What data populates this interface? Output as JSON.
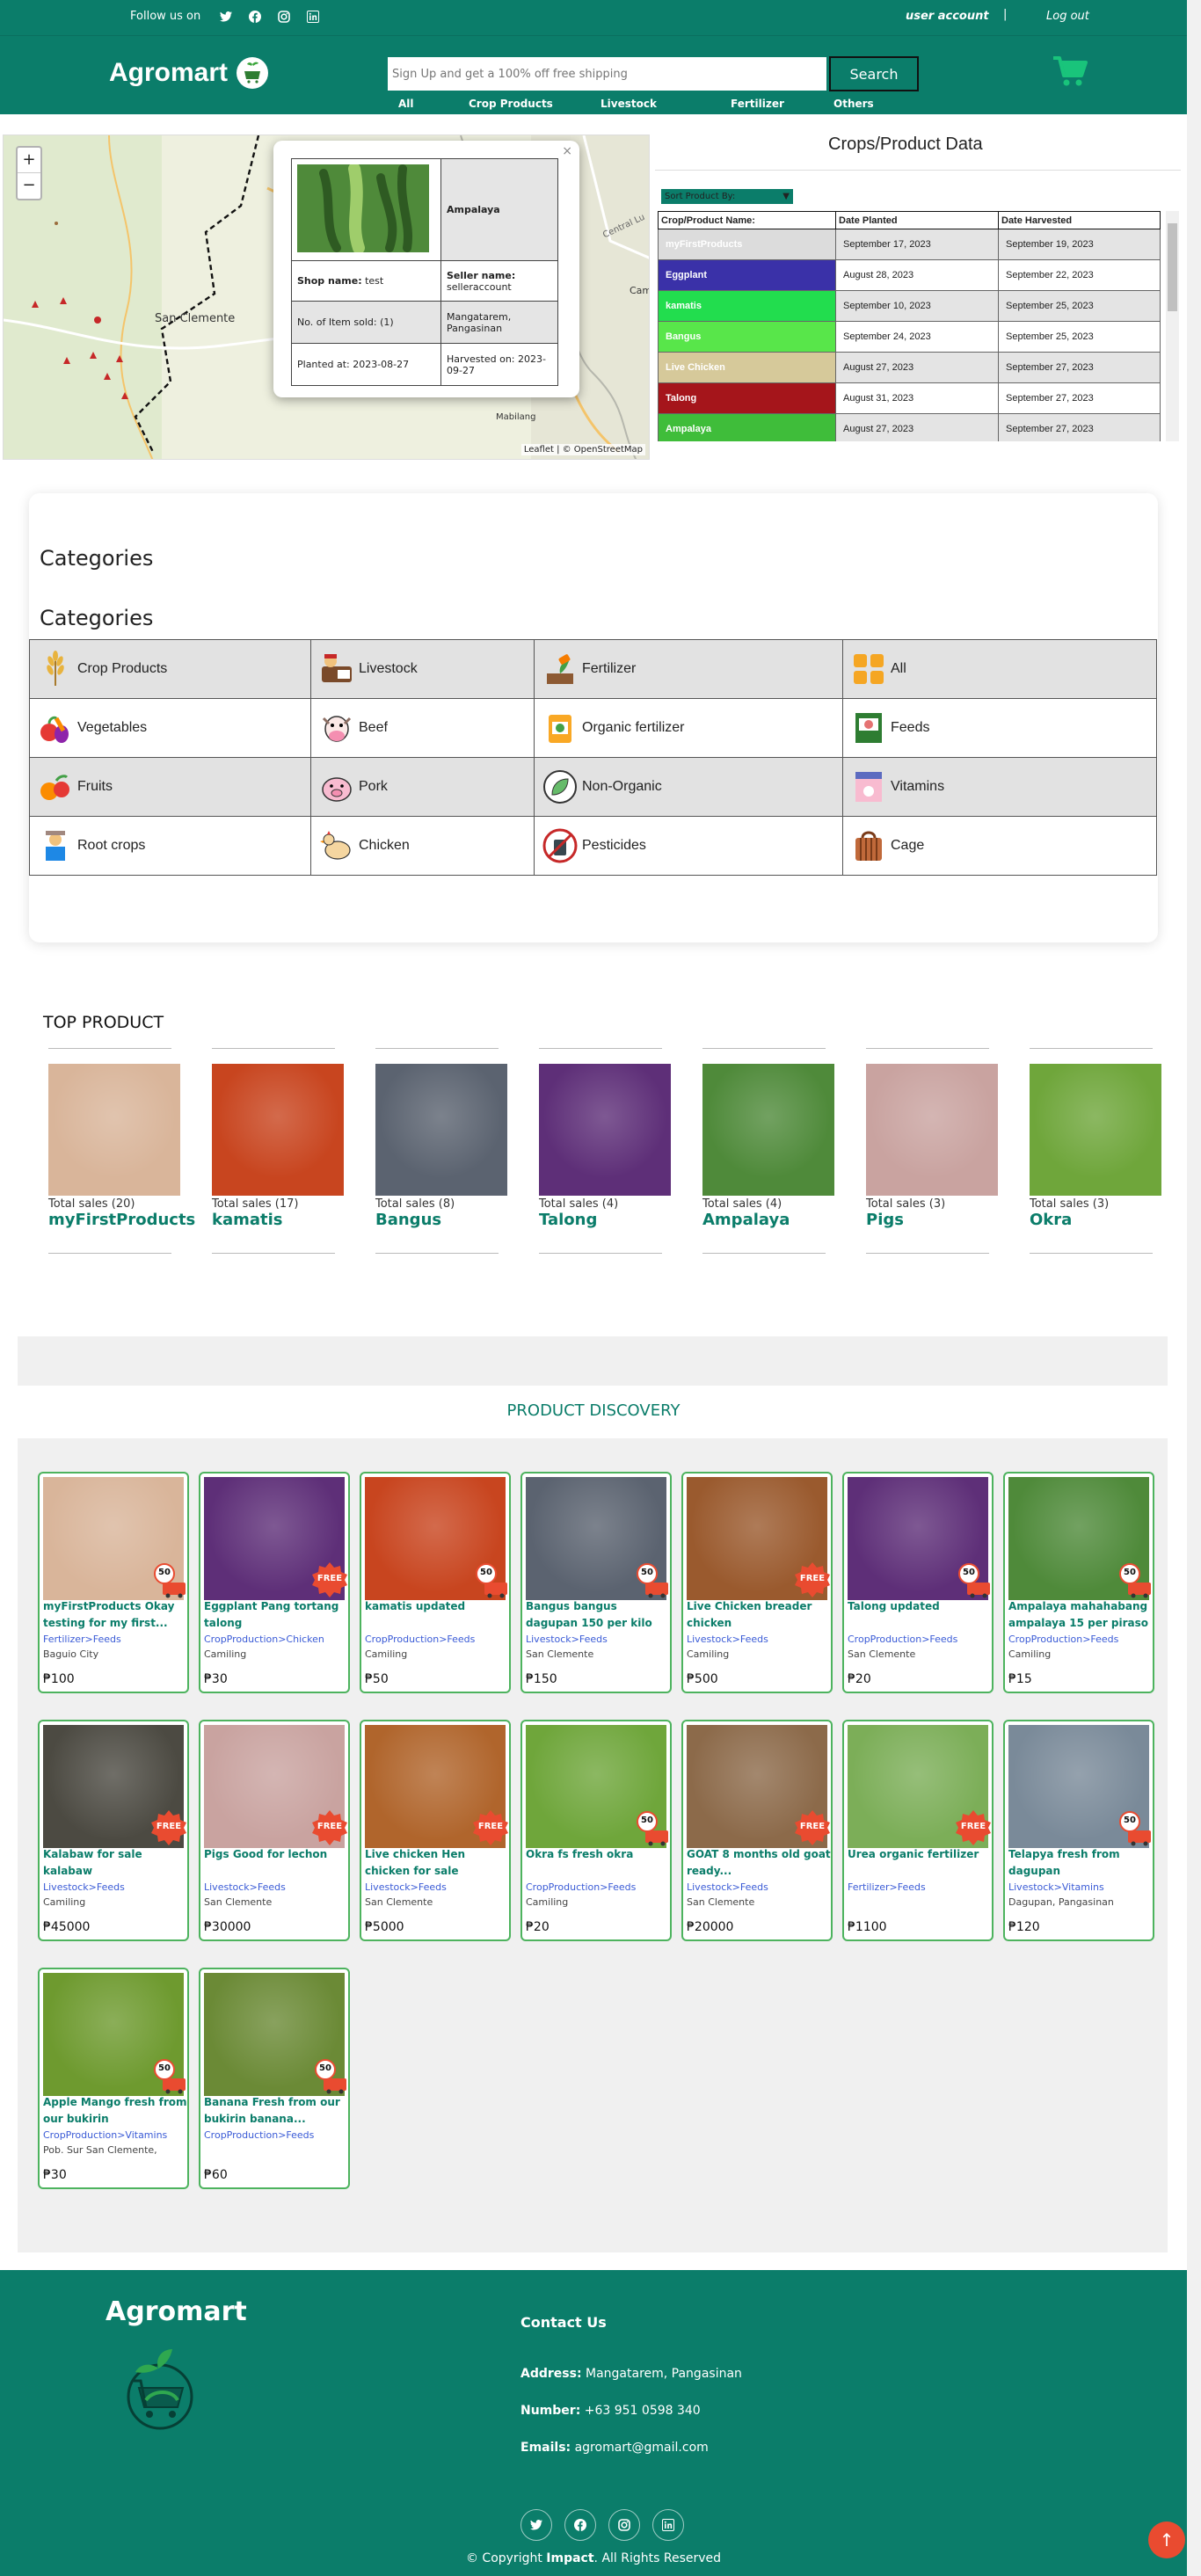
{
  "topbar": {
    "follow": "Follow us on",
    "user_account": "user account",
    "separator": "|",
    "logout": "Log out"
  },
  "header": {
    "brand": "Agromart",
    "search_placeholder": "Sign Up and get a 100% off free shipping",
    "search_button": "Search",
    "nav": [
      "All",
      "Crop Products",
      "Livestock",
      "Fertilizer",
      "Others"
    ]
  },
  "map": {
    "zoom_in": "+",
    "zoom_out": "−",
    "labels": [
      "San Clemente",
      "Camiling",
      "Mabilang",
      "Central Lu"
    ],
    "attribution": "Leaflet | © OpenStreetMap",
    "popup": {
      "close": "×",
      "name": "Ampalaya",
      "shop_label": "Shop name:",
      "shop_value": "test",
      "seller_label": "Seller name:",
      "seller_value": "selleraccount",
      "items_sold": "No. of Item sold: (1)",
      "location": "Mangatarem, Pangasinan",
      "planted": "Planted at: 2023-08-27",
      "harvested": "Harvested on: 2023-09-27"
    }
  },
  "crops": {
    "title": "Crops/Product Data",
    "sort_label": "Sort Product By:",
    "headers": [
      "Crop/Product Name:",
      "Date Planted",
      "Date Harvested"
    ],
    "rows": [
      {
        "name": "myFirstProducts",
        "planted": "September 17, 2023",
        "harvested": "September 19, 2023",
        "color": "#dcdcdc"
      },
      {
        "name": "Eggplant",
        "planted": "August 28, 2023",
        "harvested": "September 22, 2023",
        "color": "#3a31a8"
      },
      {
        "name": "kamatis",
        "planted": "September 10, 2023",
        "harvested": "September 25, 2023",
        "color": "#22dd4e"
      },
      {
        "name": "Bangus",
        "planted": "September 24, 2023",
        "harvested": "September 25, 2023",
        "color": "#58e64a"
      },
      {
        "name": "Live Chicken",
        "planted": "August 27, 2023",
        "harvested": "September 27, 2023",
        "color": "#d6c99a"
      },
      {
        "name": "Talong",
        "planted": "August 31, 2023",
        "harvested": "September 27, 2023",
        "color": "#a5151b"
      },
      {
        "name": "Ampalaya",
        "planted": "August 27, 2023",
        "harvested": "September 27, 2023",
        "color": "#3fbd3a"
      }
    ]
  },
  "categories": {
    "heading1": "Categories",
    "heading2": "Categories",
    "rows": [
      [
        {
          "label": "Crop Products",
          "icon": "wheat-icon"
        },
        {
          "label": "Livestock",
          "icon": "farmer-cow-icon"
        },
        {
          "label": "Fertilizer",
          "icon": "fertilizer-icon"
        },
        {
          "label": "All",
          "icon": "grid-icon"
        }
      ],
      [
        {
          "label": "Vegetables",
          "icon": "vegetables-icon"
        },
        {
          "label": "Beef",
          "icon": "cow-icon"
        },
        {
          "label": "Organic fertilizer",
          "icon": "organic-fertilizer-icon"
        },
        {
          "label": "Feeds",
          "icon": "feeds-icon"
        }
      ],
      [
        {
          "label": "Fruits",
          "icon": "fruits-icon"
        },
        {
          "label": "Pork",
          "icon": "pig-icon"
        },
        {
          "label": "Non-Organic",
          "icon": "leaf-icon"
        },
        {
          "label": "Vitamins",
          "icon": "vitamins-icon"
        }
      ],
      [
        {
          "label": "Root crops",
          "icon": "farmer-icon"
        },
        {
          "label": "Chicken",
          "icon": "chicken-icon"
        },
        {
          "label": "Pesticides",
          "icon": "pesticide-icon"
        },
        {
          "label": "Cage",
          "icon": "cage-icon"
        }
      ]
    ]
  },
  "top_products": {
    "title": "TOP PRODUCT",
    "items": [
      {
        "sales": "Total sales (20)",
        "name": "myFirstProducts",
        "color": "#d9b59a"
      },
      {
        "sales": "Total sales (17)",
        "name": "kamatis",
        "color": "#c8451f"
      },
      {
        "sales": "Total sales (8)",
        "name": "Bangus",
        "color": "#5b6370"
      },
      {
        "sales": "Total sales (4)",
        "name": "Talong",
        "color": "#5e2f78"
      },
      {
        "sales": "Total sales (4)",
        "name": "Ampalaya",
        "color": "#4f8a3a"
      },
      {
        "sales": "Total sales (3)",
        "name": "Pigs",
        "color": "#c9a3a0"
      },
      {
        "sales": "Total sales (3)",
        "name": "Okra",
        "color": "#6fa63b"
      }
    ]
  },
  "discovery": {
    "title": "PRODUCT DISCOVERY",
    "products": [
      {
        "title": "myFirstProducts Okay testing for my first...",
        "category": "Fertilizer>Feeds",
        "location": "Baguio City",
        "price": "₱100",
        "badge": "50",
        "color": "#d9b59a"
      },
      {
        "title": "Eggplant Pang tortang talong",
        "category": "CropProduction>Chicken",
        "location": "Camiling",
        "price": "₱30",
        "badge": "FREE",
        "color": "#5e2f78"
      },
      {
        "title": "kamatis updated",
        "category": "CropProduction>Feeds",
        "location": "Camiling",
        "price": "₱50",
        "badge": "50",
        "color": "#c8451f"
      },
      {
        "title": "Bangus bangus dagupan 150 per kilo",
        "category": "Livestock>Feeds",
        "location": "San Clemente",
        "price": "₱150",
        "badge": "50",
        "color": "#5b6370"
      },
      {
        "title": "Live Chicken breader chicken",
        "category": "Livestock>Feeds",
        "location": "Camiling",
        "price": "₱500",
        "badge": "FREE",
        "color": "#9a5a2e"
      },
      {
        "title": "Talong updated",
        "category": "CropProduction>Feeds",
        "location": "San Clemente",
        "price": "₱20",
        "badge": "50",
        "color": "#5e2f78"
      },
      {
        "title": "Ampalaya mahahabang ampalaya 15 per piraso",
        "category": "CropProduction>Feeds",
        "location": "Camiling",
        "price": "₱15",
        "badge": "50",
        "color": "#4f8a3a"
      },
      {
        "title": "Kalabaw for sale kalabaw",
        "category": "Livestock>Feeds",
        "location": "Camiling",
        "price": "₱45000",
        "badge": "FREE",
        "color": "#4c4a42"
      },
      {
        "title": "Pigs Good for lechon",
        "category": "Livestock>Feeds",
        "location": "San Clemente",
        "price": "₱30000",
        "badge": "FREE",
        "color": "#c9a3a0"
      },
      {
        "title": "Live chicken Hen chicken for sale",
        "category": "Livestock>Feeds",
        "location": "San Clemente",
        "price": "₱5000",
        "badge": "FREE",
        "color": "#b0652c"
      },
      {
        "title": "Okra fs fresh okra",
        "category": "CropProduction>Feeds",
        "location": "Camiling",
        "price": "₱20",
        "badge": "50",
        "color": "#6fa63b"
      },
      {
        "title": "GOAT 8 months old goat ready...",
        "category": "Livestock>Feeds",
        "location": "San Clemente",
        "price": "₱20000",
        "badge": "FREE",
        "color": "#8c6a4a"
      },
      {
        "title": "Urea organic fertilizer",
        "category": "Fertilizer>Feeds",
        "location": "",
        "price": "₱1100",
        "badge": "FREE",
        "color": "#7cae58"
      },
      {
        "title": "Telapya fresh from dagupan",
        "category": "Livestock>Vitamins",
        "location": "Dagupan, Pangasinan",
        "price": "₱120",
        "badge": "50",
        "color": "#7a8a99"
      },
      {
        "title": "Apple Mango fresh from our bukirin",
        "category": "CropProduction>Vitamins",
        "location": "Pob. Sur San Clemente,",
        "price": "₱30",
        "badge": "50",
        "color": "#6e9a2f"
      },
      {
        "title": "Banana Fresh from our bukirin banana...",
        "category": "CropProduction>Feeds",
        "location": "",
        "price": "₱60",
        "badge": "50",
        "color": "#6b8a36"
      }
    ]
  },
  "footer": {
    "brand": "Agromart",
    "contact_title": "Contact Us",
    "address_label": "Address:",
    "address": "Mangatarem, Pangasinan",
    "number_label": "Number:",
    "number": "+63 951 0598 340",
    "email_label": "Emails:",
    "email": "agromart@gmail.com",
    "copyright_pre": "© Copyright ",
    "copyright_brand": "Impact",
    "copyright_post": ". All Rights Reserved"
  },
  "colors": {
    "brand": "#0b7d6a",
    "accent": "#e94b30",
    "card_border": "#4db35e"
  }
}
